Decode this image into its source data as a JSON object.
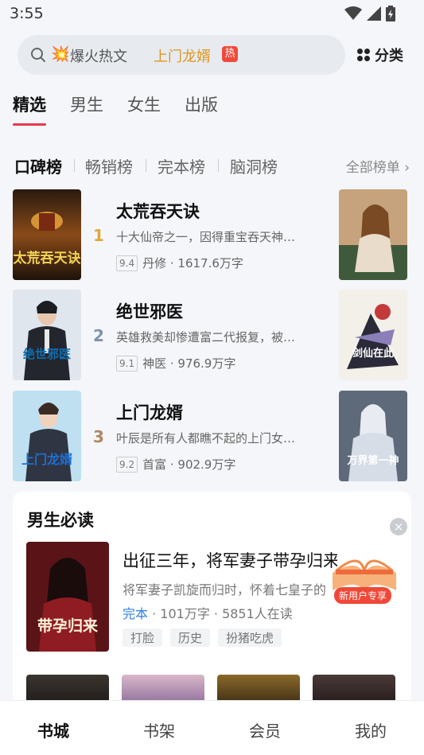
{
  "status_bar": {
    "time": "3:55"
  },
  "search": {
    "hint": "爆火热文",
    "hot_word": "上门龙婿",
    "hot_badge": "热"
  },
  "category_label": "分类",
  "main_tabs": [
    {
      "label": "精选",
      "active": true
    },
    {
      "label": "男生",
      "active": false
    },
    {
      "label": "女生",
      "active": false
    },
    {
      "label": "出版",
      "active": false
    }
  ],
  "rank_tabs": [
    {
      "label": "口碑榜",
      "active": true
    },
    {
      "label": "畅销榜",
      "active": false
    },
    {
      "label": "完本榜",
      "active": false
    },
    {
      "label": "脑洞榜",
      "active": false
    }
  ],
  "all_rank_label": "全部榜单",
  "rank_list": [
    {
      "rank": "1",
      "rank_color": "#e0a83a",
      "title": "太荒吞天诀",
      "desc": "十大仙帝之一，因得重宝吞天神…",
      "score": "9.4",
      "meta": "丹修 · 1617.6万字",
      "cover_text": "太荒吞天诀"
    },
    {
      "rank": "2",
      "rank_color": "#7f93ad",
      "title": "绝世邪医",
      "desc": "英雄救美却惨遭富二代报复，被…",
      "score": "9.1",
      "meta": "神医 · 976.9万字",
      "cover_text": "绝世邪医"
    },
    {
      "rank": "3",
      "rank_color": "#b08766",
      "title": "上门龙婿",
      "desc": "叶辰是所有人都瞧不起的上门女…",
      "score": "9.2",
      "meta": "首富 · 902.9万字",
      "cover_text": "上门龙婿"
    }
  ],
  "side_covers": [
    "",
    "剑仙在此",
    "万界第一神"
  ],
  "must_read": {
    "title": "男生必读",
    "close_label": "×",
    "book_title": "出征三年，将军妻子带孕归来",
    "desc": "将军妻子凯旋而归时，怀着七皇子的",
    "status": "完本",
    "meta": " · 101万字 · 5851人在读",
    "tags": [
      "打脸",
      "历史",
      "扮猪吃虎"
    ],
    "cover_text": "带孕归来",
    "promo_label": "新用户专享"
  },
  "bottom_nav": [
    {
      "label": "书城",
      "active": true
    },
    {
      "label": "书架",
      "active": false
    },
    {
      "label": "会员",
      "active": false
    },
    {
      "label": "我的",
      "active": false
    }
  ]
}
